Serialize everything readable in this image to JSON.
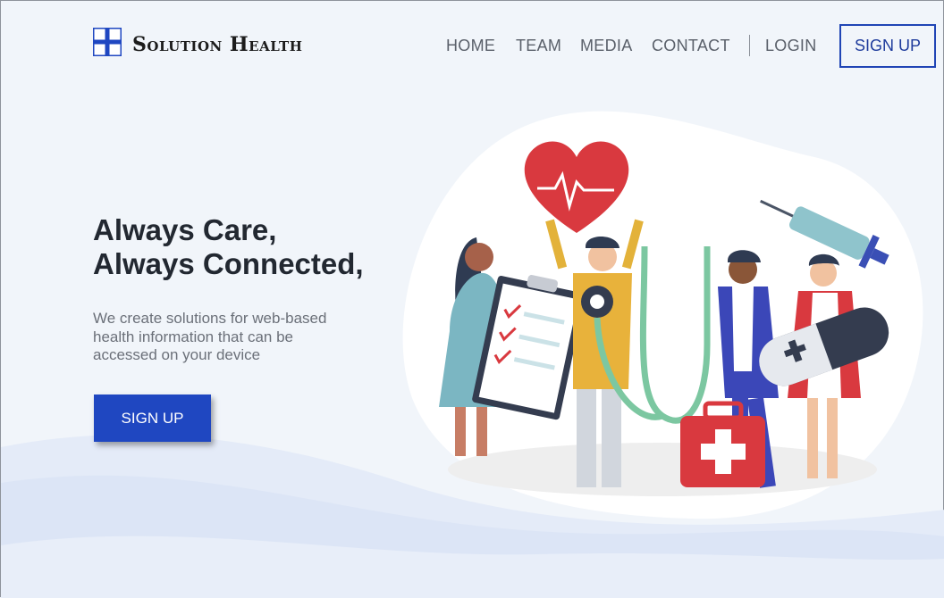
{
  "brand": {
    "name": "Solution Health",
    "logo_color": "#1f47c1"
  },
  "nav": {
    "items": [
      {
        "label": "HOME"
      },
      {
        "label": "TEAM"
      },
      {
        "label": "MEDIA"
      },
      {
        "label": "CONTACT"
      }
    ],
    "login": "LOGIN",
    "signup": "SIGN UP"
  },
  "hero": {
    "title_line1": "Always Care,",
    "title_line2": "Always Connected,",
    "description": "We create solutions for web-based health information that can be accessed on your device",
    "cta": "SIGN UP"
  },
  "colors": {
    "accent": "#1f47c1",
    "background": "#f1f5fa",
    "wave": "#dfe7f7"
  },
  "illustration": {
    "icons": [
      "heart-icon",
      "syringe-icon",
      "clipboard-icon",
      "stethoscope-icon",
      "first-aid-kit-icon",
      "pill-icon"
    ]
  }
}
